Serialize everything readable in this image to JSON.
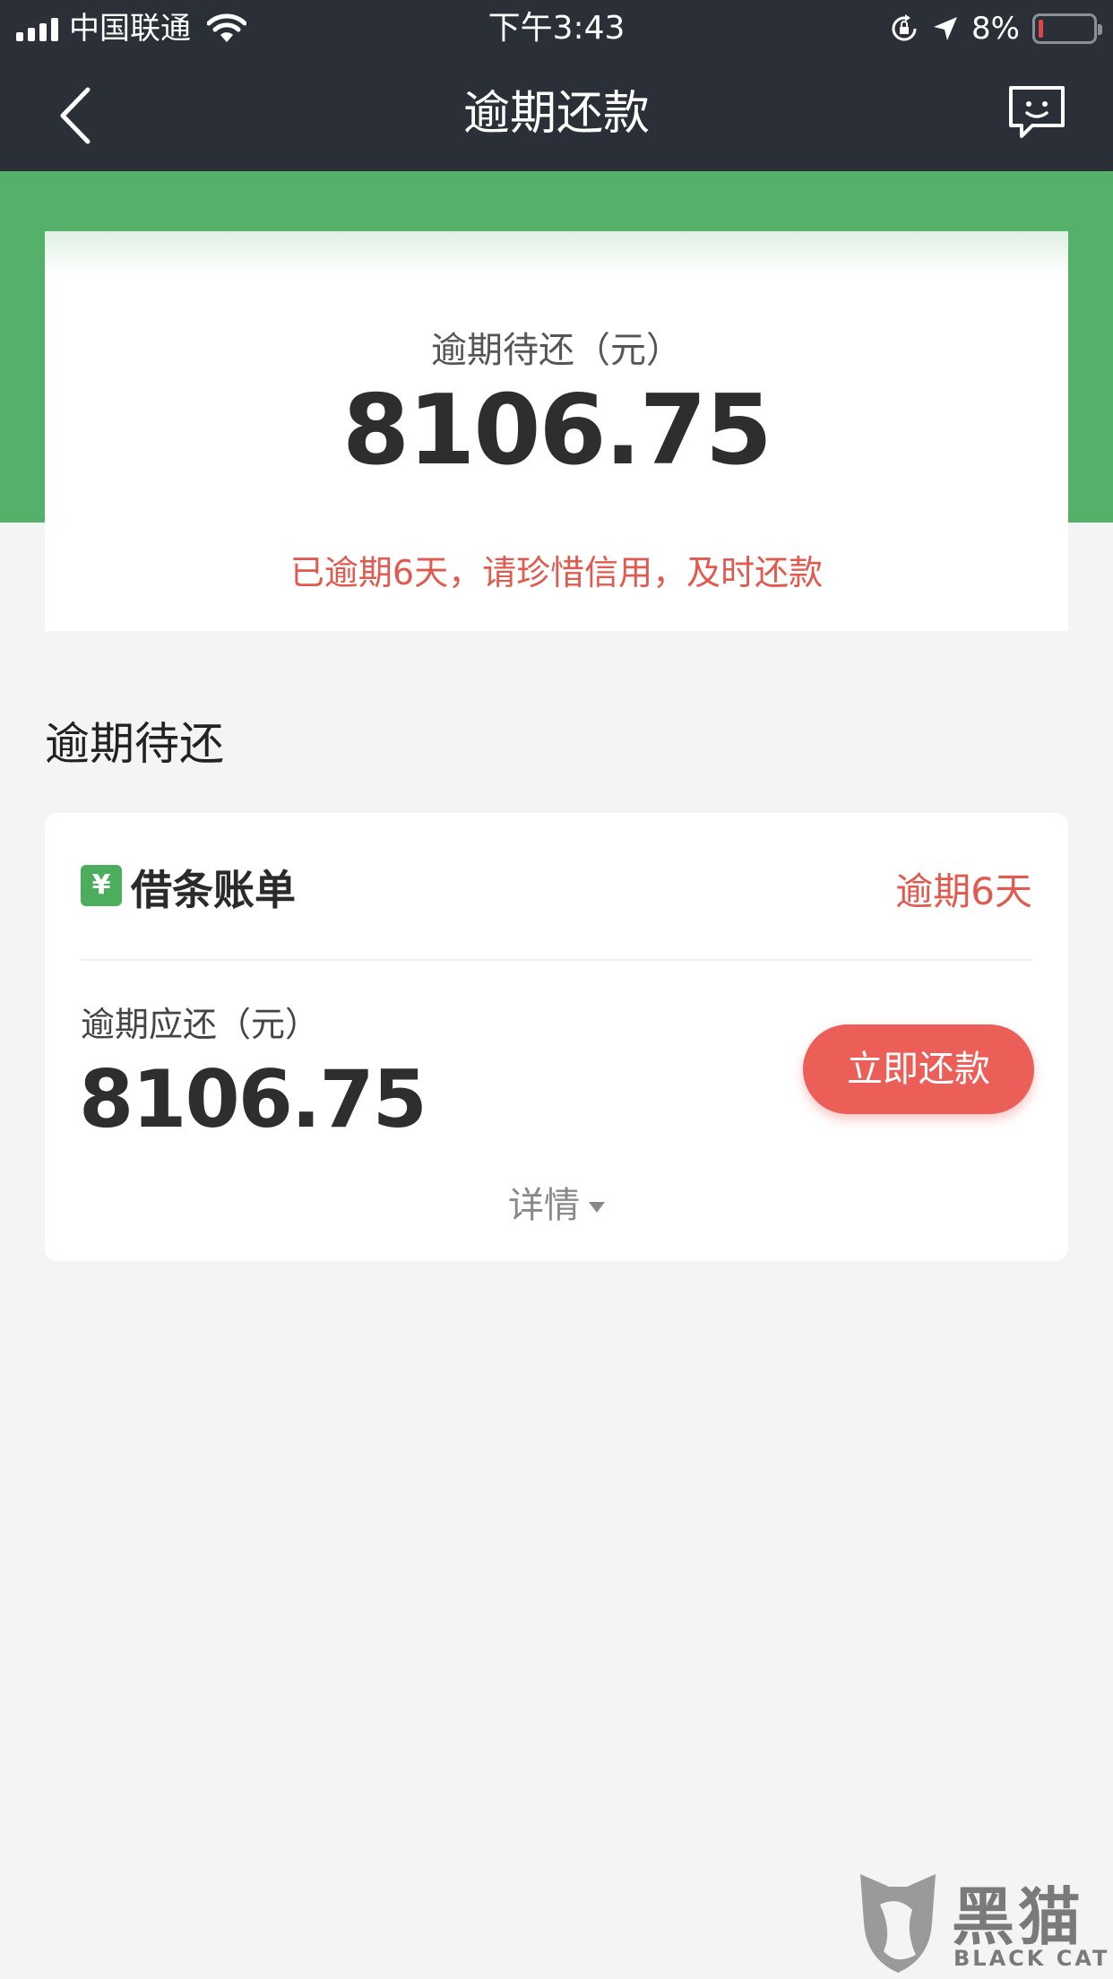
{
  "status_bar": {
    "carrier": "中国联通",
    "time": "下午3:43",
    "battery_percent": "8%",
    "battery_level": 0.08,
    "icons": [
      "signal-icon",
      "wifi-icon",
      "rotation-lock-icon",
      "location-icon",
      "battery-icon"
    ]
  },
  "nav": {
    "title": "逾期还款",
    "back_icon": "chevron-left-icon",
    "feedback_icon": "feedback-chat-icon"
  },
  "summary": {
    "label": "逾期待还（元）",
    "amount": "8106.75",
    "warning": "已逾期6天，请珍惜信用，及时还款"
  },
  "section": {
    "title": "逾期待还"
  },
  "bill": {
    "icon_glyph": "¥",
    "title": "借条账单",
    "status": "逾期6天",
    "due_label": "逾期应还（元）",
    "due_amount": "8106.75",
    "pay_button": "立即还款",
    "details": "详情"
  },
  "watermark": {
    "cn": "黑猫",
    "en": "BLACK CAT"
  },
  "colors": {
    "nav_bg": "#2b2f37",
    "green": "#55b06a",
    "accent_red": "#e05a4f",
    "button_red": "#ec5f58"
  }
}
